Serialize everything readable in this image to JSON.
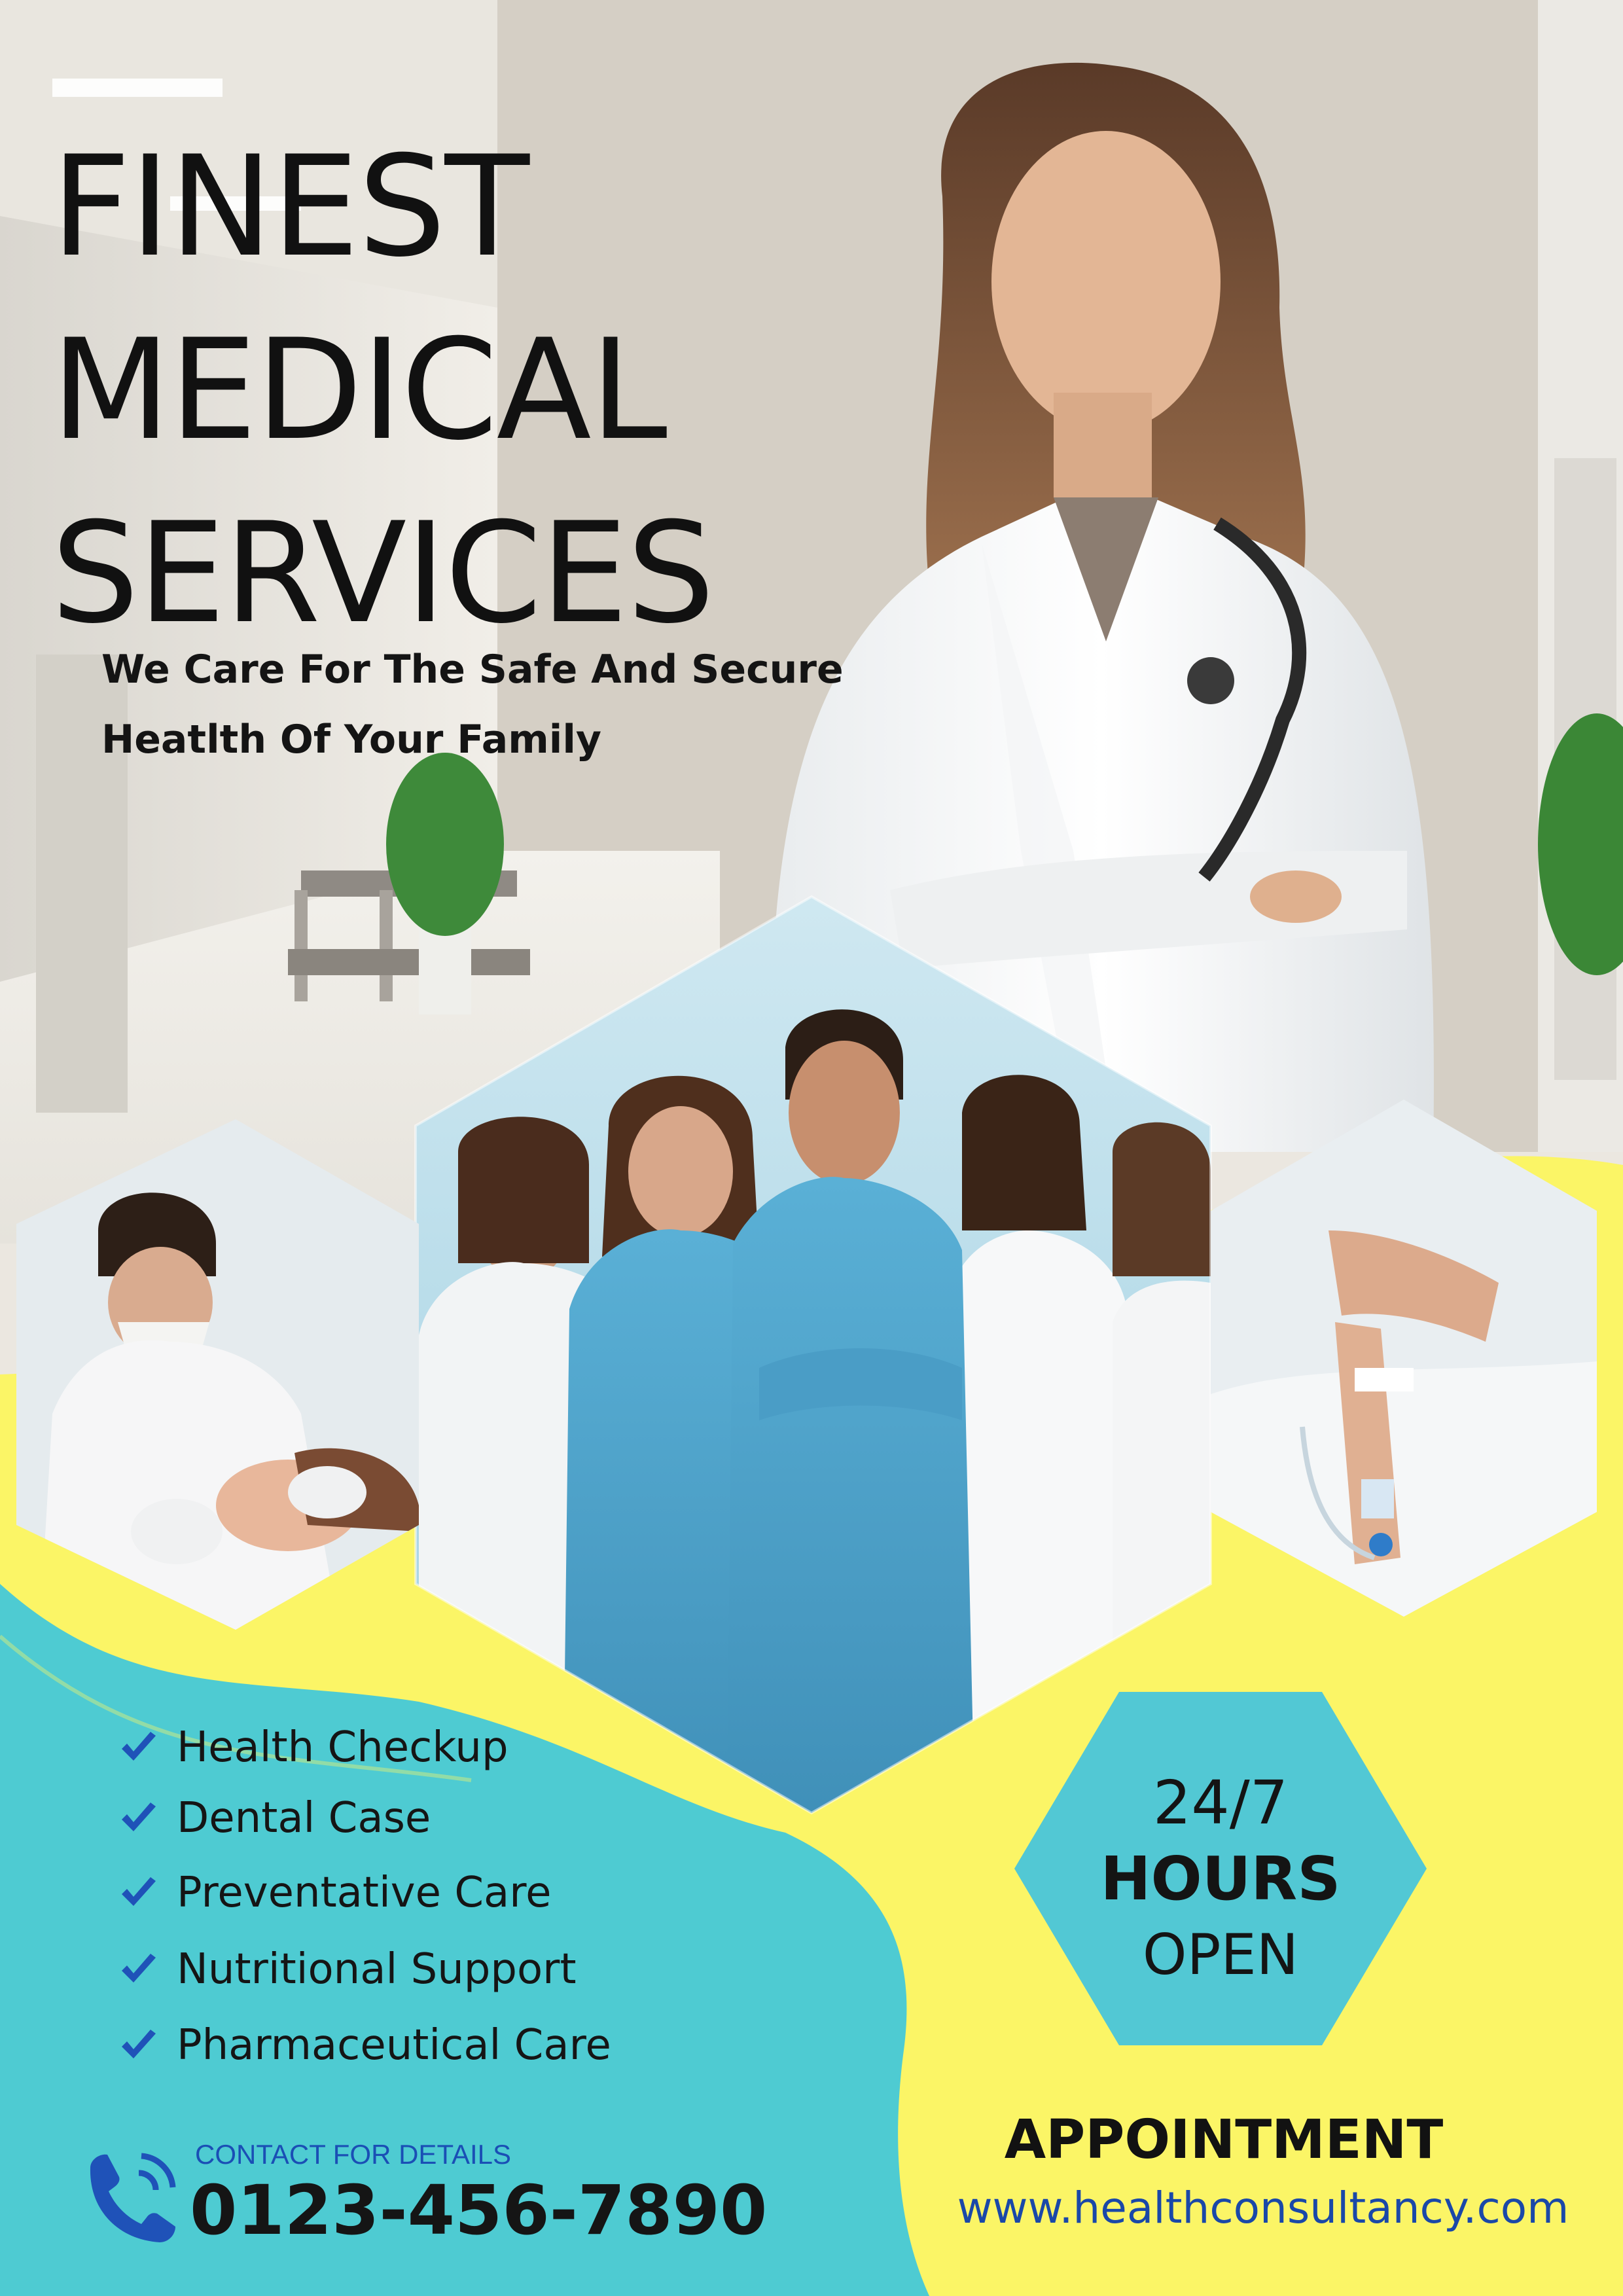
{
  "headline": {
    "line1": "FINEST",
    "line2": "MEDICAL",
    "line3": "SERVICES"
  },
  "subheadline": {
    "line1": "We Care For The  Safe And Secure",
    "line2": "Heatlth Of Your Family"
  },
  "services": [
    {
      "label": "Health Checkup",
      "icon": "check-icon"
    },
    {
      "label": "Dental Case",
      "icon": "check-icon"
    },
    {
      "label": "Preventative Care",
      "icon": "check-icon"
    },
    {
      "label": "Nutritional Support",
      "icon": "check-icon"
    },
    {
      "label": "Pharmaceutical Care",
      "icon": "check-icon"
    }
  ],
  "hours_badge": {
    "line1": "24/7",
    "line2": "HOURS",
    "line3": "OPEN"
  },
  "contact": {
    "label": "CONTACT FOR DETAILS",
    "phone": "0123-456-7890",
    "icon": "phone-icon"
  },
  "appointment": {
    "label": "APPOINTMENT",
    "url": "www.healthconsultancy.com"
  },
  "colors": {
    "yellow": "#fbf566",
    "teal": "#4ecbd2",
    "hexagon_teal": "#52c8d4",
    "check_blue": "#1f52b8",
    "link_blue": "#1a48a8"
  },
  "images": [
    "doctor-portrait-photo",
    "hospital-corridor-photo",
    "dentist-photo",
    "medical-team-photo",
    "patient-iv-photo"
  ]
}
